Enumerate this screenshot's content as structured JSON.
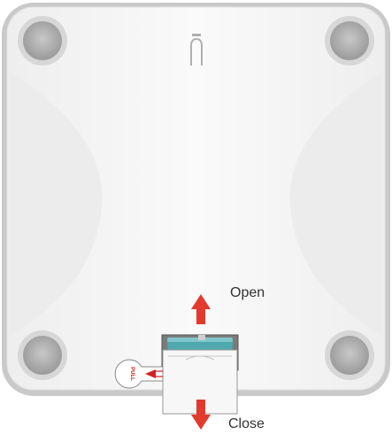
{
  "illustration": {
    "open_label": "Open",
    "close_label": "Close",
    "pull_tab_label": "PULL",
    "colors": {
      "scale_body": "#f5f5f5",
      "scale_edge": "#bdbdbd",
      "foot": "#a9a9a9",
      "arrow": "#e23a2c",
      "battery": "#4fa8ad"
    }
  }
}
